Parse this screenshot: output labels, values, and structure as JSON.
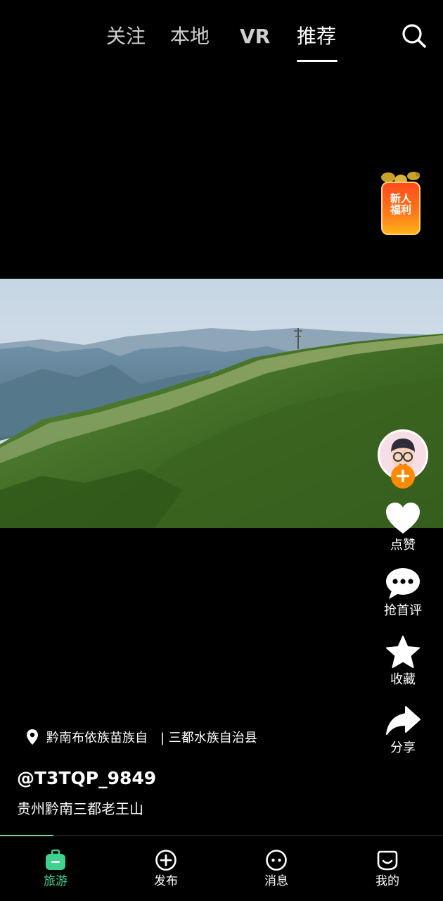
{
  "top_tabs": {
    "items": [
      {
        "label": "关注"
      },
      {
        "label": "本地"
      },
      {
        "label": "VR"
      },
      {
        "label": "推荐"
      }
    ],
    "active_index": 3
  },
  "promo": {
    "label": "新人\n福利"
  },
  "video": {
    "subject": "aerial mountain landscape"
  },
  "actions": {
    "like": "点赞",
    "comment": "抢首评",
    "favorite": "收藏",
    "share": "分享"
  },
  "post": {
    "location_region": "黔南布依族苗族自",
    "location_county": "| 三都水族自治县",
    "username": "@T3TQP_9849",
    "caption": "贵州黔南三都老王山"
  },
  "progress": {
    "fraction": 0.12
  },
  "bottom_nav": {
    "items": [
      {
        "label": "旅游",
        "icon": "suitcase-icon"
      },
      {
        "label": "发布",
        "icon": "plus-circle-icon"
      },
      {
        "label": "消息",
        "icon": "message-face-icon"
      },
      {
        "label": "我的",
        "icon": "profile-face-icon"
      }
    ],
    "active_index": 0
  },
  "colors": {
    "accent_green": "#3fd28e",
    "follow_orange": "#ff8a00",
    "promo_red": "#ff4a1c"
  }
}
